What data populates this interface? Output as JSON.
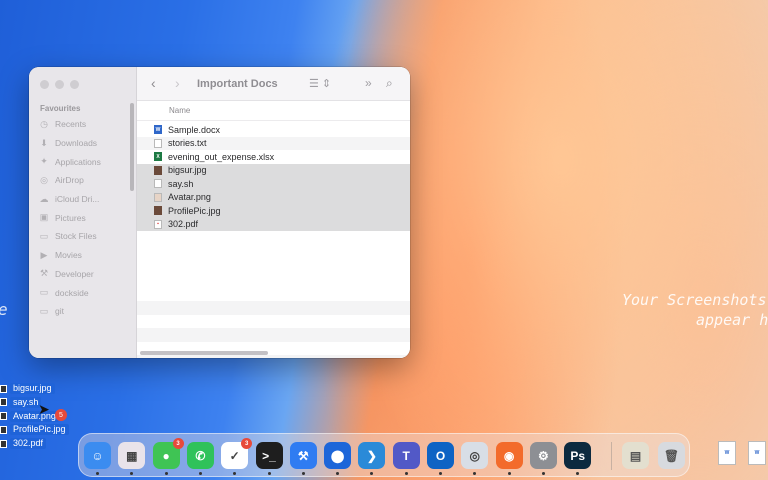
{
  "finder": {
    "window_title": "Important Docs",
    "sidebar_header": "Favourites",
    "sidebar_items": [
      {
        "label": "Recents",
        "icon": "clock-icon"
      },
      {
        "label": "Downloads",
        "icon": "download-icon"
      },
      {
        "label": "Applications",
        "icon": "applications-icon"
      },
      {
        "label": "AirDrop",
        "icon": "airdrop-icon"
      },
      {
        "label": "iCloud Dri...",
        "icon": "cloud-icon"
      },
      {
        "label": "Pictures",
        "icon": "pictures-icon"
      },
      {
        "label": "Stock Files",
        "icon": "folder-icon"
      },
      {
        "label": "Movies",
        "icon": "movies-icon"
      },
      {
        "label": "Developer",
        "icon": "hammer-icon"
      },
      {
        "label": "dockside",
        "icon": "folder-icon"
      },
      {
        "label": "git",
        "icon": "folder-icon"
      }
    ],
    "column_name": "Name",
    "files": [
      {
        "name": "Sample.docx",
        "type": "docx",
        "selected": false
      },
      {
        "name": "stories.txt",
        "type": "txt",
        "selected": false
      },
      {
        "name": "evening_out_expense.xlsx",
        "type": "xlsx",
        "selected": false
      },
      {
        "name": "bigsur.jpg",
        "type": "jpg",
        "selected": true
      },
      {
        "name": "say.sh",
        "type": "sh",
        "selected": true
      },
      {
        "name": "Avatar.png",
        "type": "png",
        "selected": true
      },
      {
        "name": "ProfilePic.jpg",
        "type": "jpg",
        "selected": true
      },
      {
        "name": "302.pdf",
        "type": "pdf",
        "selected": true
      }
    ]
  },
  "desktop": {
    "left_fragment": "e",
    "hint_line1": "Your Screenshots",
    "hint_line2": "appear he"
  },
  "drag": {
    "items": [
      "bigsur.jpg",
      "say.sh",
      "Avatar.png",
      "ProfilePic.jpg",
      "302.pdf"
    ],
    "badge": "5"
  },
  "dock": {
    "apps": [
      {
        "name": "finder-icon",
        "bg": "#3b8cf0",
        "glyph": "☺"
      },
      {
        "name": "launchpad-icon",
        "bg": "#e9e3ea",
        "glyph": "▦"
      },
      {
        "name": "messages-icon",
        "bg": "#3fc454",
        "glyph": "●",
        "badge": "3"
      },
      {
        "name": "whatsapp-icon",
        "bg": "#2fc25a",
        "glyph": "✆"
      },
      {
        "name": "tasks-icon",
        "bg": "#ffffff",
        "glyph": "✓",
        "badge": "3"
      },
      {
        "name": "terminal-icon",
        "bg": "#1e1e1e",
        "glyph": ">_"
      },
      {
        "name": "xcode-icon",
        "bg": "#2f7cf2",
        "glyph": "⚒"
      },
      {
        "name": "maps-pin-icon",
        "bg": "#1d66d9",
        "glyph": "⬤"
      },
      {
        "name": "vscode-icon",
        "bg": "#2a8ad8",
        "glyph": "❯"
      },
      {
        "name": "teams-icon",
        "bg": "#5259c7",
        "glyph": "T"
      },
      {
        "name": "outlook-icon",
        "bg": "#0e63c4",
        "glyph": "O"
      },
      {
        "name": "quicktime-icon",
        "bg": "#d8dee6",
        "glyph": "◎"
      },
      {
        "name": "firefox-icon",
        "bg": "#f36b2b",
        "glyph": "◉"
      },
      {
        "name": "system-settings-icon",
        "bg": "#8d8f94",
        "glyph": "⚙"
      },
      {
        "name": "photoshop-icon",
        "bg": "#0c2a3f",
        "glyph": "Ps"
      }
    ],
    "right_items": [
      {
        "name": "archive-icon",
        "bg": "#e3dfcf",
        "glyph": "▤"
      },
      {
        "name": "trash-icon",
        "bg": "#d7dadf",
        "glyph": "🗑"
      }
    ]
  }
}
